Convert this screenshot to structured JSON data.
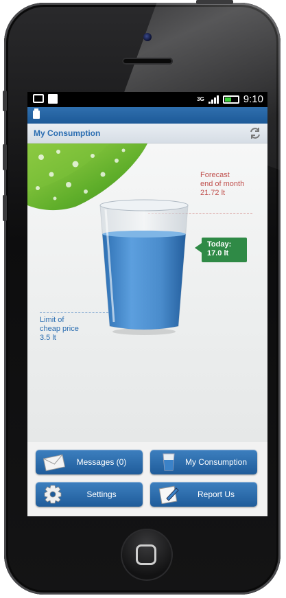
{
  "status_bar": {
    "network": "3G",
    "time": "9:10"
  },
  "title_bar": {
    "title": "My Consumption"
  },
  "gauge": {
    "forecast_label": "Forecast\nend of month",
    "forecast_value": "21.72 lt",
    "today_label": "Today:",
    "today_value": "17.0 lt",
    "limit_label": "Limit of\ncheap price",
    "limit_value": "3.5 lt",
    "today_fraction": 0.78
  },
  "menu": {
    "messages": "Messages (0)",
    "my_consumption": "My Consumption",
    "settings": "Settings",
    "report_us": "Report Us"
  },
  "colors": {
    "accent_blue": "#2a6db1",
    "button_blue": "#2f6fae",
    "today_green": "#2f8a46",
    "forecast_red": "#c0504d",
    "water": "#4a90d0"
  }
}
